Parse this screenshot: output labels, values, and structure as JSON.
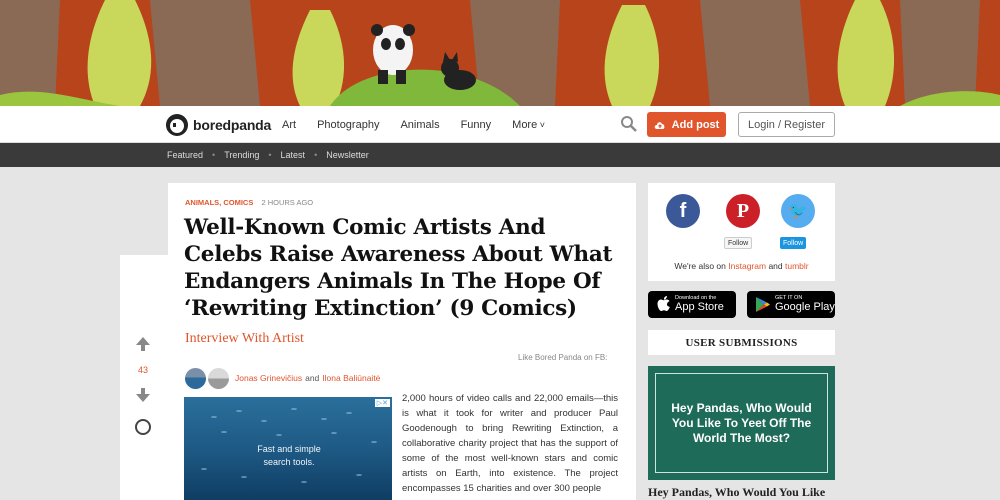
{
  "header": {
    "logo_text": "boredpanda",
    "nav": [
      "Art",
      "Photography",
      "Animals",
      "Funny",
      "More"
    ],
    "add_post": "Add post",
    "login": "Login / Register"
  },
  "subnav": [
    "Featured",
    "Trending",
    "Latest",
    "Newsletter"
  ],
  "article": {
    "categories": "ANIMALS, COMICS",
    "time": "2 HOURS AGO",
    "title": "Well-Known Comic Artists And Celebs Raise Awareness About What Endangers Animals In The Hope Of ‘Rewriting Extinction’ (9 Comics)",
    "subtitle": "Interview With Artist",
    "fb_like": "Like Bored Panda on FB:",
    "author1": "Jonas Grinevičius",
    "and": "and",
    "author2": "Ilona Baliūnaitė",
    "ad_text_1": "Fast and simple",
    "ad_text_2": "search tools.",
    "body": "2,000 hours of video calls and 22,000 emails—this is what it took for writer and producer Paul Goodenough to bring Rewriting Extinction, a collaborative charity project that has the support of some of the most well-known stars and comic artists on Earth, into existence. The project encompasses 15 charities and over 300 people"
  },
  "vote": {
    "count": "43"
  },
  "sidebar": {
    "pin_follow": "Follow",
    "tw_follow": "Follow",
    "also_prefix": "We're also on",
    "instagram": "Instagram",
    "and": "and",
    "tumblr": "tumblr",
    "app_store_small": "Download on the",
    "app_store_big": "App Store",
    "google_small": "GET IT ON",
    "google_big": "Google Play",
    "submissions": "USER SUBMISSIONS",
    "promo_text": "Hey Pandas, Who Would You Like To Yeet Off The World The Most?",
    "promo_caption": "Hey Pandas, Who Would You Like"
  },
  "colors": {
    "accent": "#e0552c",
    "subnav_bg": "#3a3a3a",
    "facebook": "#3b5998",
    "pinterest": "#cb2027",
    "twitter": "#55acee",
    "promo_bg": "#1f6b5a"
  }
}
